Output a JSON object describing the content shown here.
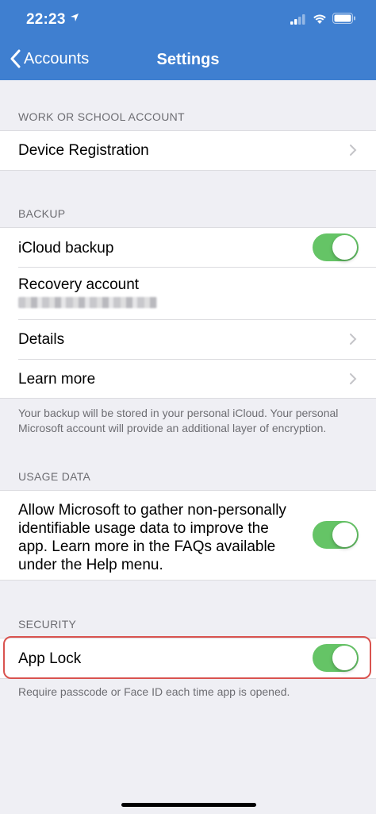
{
  "status_bar": {
    "time": "22:23"
  },
  "nav": {
    "back_label": "Accounts",
    "title": "Settings"
  },
  "work_section": {
    "header": "WORK OR SCHOOL ACCOUNT",
    "device_registration": "Device Registration"
  },
  "backup_section": {
    "header": "BACKUP",
    "icloud_backup": "iCloud backup",
    "icloud_backup_on": true,
    "recovery_account": "Recovery account",
    "details": "Details",
    "learn_more": "Learn more",
    "footer": "Your backup will be stored in your personal iCloud. Your personal Microsoft account will provide an additional layer of encryption."
  },
  "usage_section": {
    "header": "USAGE DATA",
    "text": "Allow Microsoft to gather non-personally identifiable usage data to improve the app. Learn more in the FAQs available under the Help menu.",
    "enabled": true
  },
  "security_section": {
    "header": "SECURITY",
    "app_lock": "App Lock",
    "app_lock_on": true,
    "footer": "Require passcode or Face ID each time app is opened."
  },
  "colors": {
    "nav_blue": "#3f7fd0",
    "toggle_green": "#65c466",
    "highlight_red": "#d9534f"
  }
}
